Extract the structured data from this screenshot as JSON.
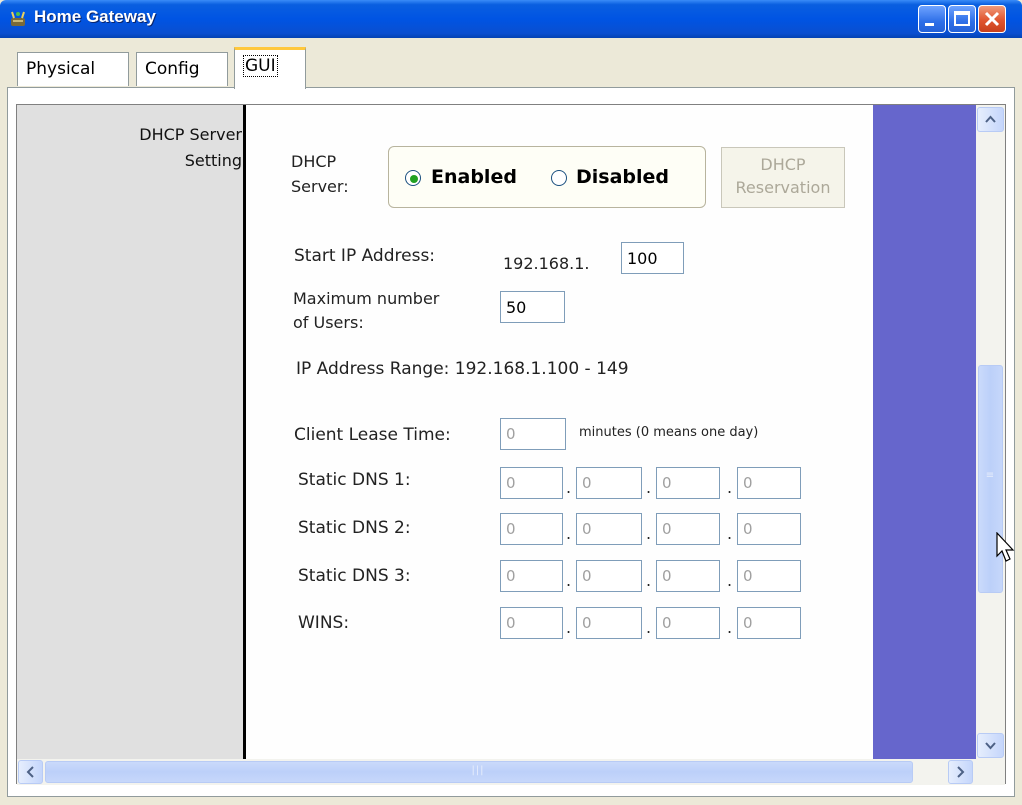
{
  "window": {
    "title": "Home Gateway",
    "icon": "router-icon",
    "controls": [
      "minimize-icon",
      "maximize-icon",
      "close-icon"
    ]
  },
  "tabs": [
    {
      "label": "Physical",
      "active": false
    },
    {
      "label": "Config",
      "active": false
    },
    {
      "label": "GUI",
      "active": true
    }
  ],
  "section": {
    "line1": "DHCP Server",
    "line2": "Setting"
  },
  "dhcp": {
    "label_line1": "DHCP",
    "label_line2": "Server:",
    "enabled_label": "Enabled",
    "disabled_label": "Disabled",
    "selected": "Enabled",
    "reservation_line1": "DHCP",
    "reservation_line2": "Reservation"
  },
  "start_ip": {
    "label": "Start IP Address:",
    "prefix": "192.168.1.",
    "value": "100"
  },
  "max_users": {
    "label_line1": "Maximum number",
    "label_line2": "of Users:",
    "value": "50"
  },
  "ip_range": {
    "label": "IP Address Range: 192.168.1.100 - 149"
  },
  "lease": {
    "label": "Client Lease Time:",
    "value": "0",
    "hint": "minutes (0 means one day)"
  },
  "dns_rows": [
    {
      "label": "Static DNS 1:",
      "octets": [
        "0",
        "0",
        "0",
        "0"
      ]
    },
    {
      "label": "Static DNS 2:",
      "octets": [
        "0",
        "0",
        "0",
        "0"
      ]
    },
    {
      "label": "Static DNS 3:",
      "octets": [
        "0",
        "0",
        "0",
        "0"
      ]
    },
    {
      "label": "WINS:",
      "octets": [
        "0",
        "0",
        "0",
        "0"
      ]
    }
  ],
  "colors": {
    "titlebar": "#0054E3",
    "tab_highlight": "#FFC83C",
    "right_panel": "#6666CC",
    "radio_selected": "#21A121"
  }
}
